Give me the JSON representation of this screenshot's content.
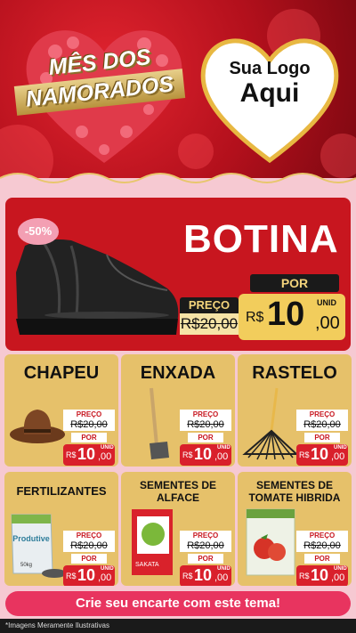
{
  "header": {
    "promo_line1": "MÊS DOS",
    "promo_line2": "NAMORADOS",
    "logo_line1": "Sua Logo",
    "logo_line2": "Aqui"
  },
  "hero": {
    "discount": "-50%",
    "title": "BOTINA",
    "old_label": "PREÇO",
    "old_price": "R$20,00",
    "por_label": "POR",
    "currency": "R$",
    "price_int": "10",
    "price_dec": ",00",
    "unit": "UNID"
  },
  "products": [
    {
      "title": "CHAPEU",
      "old_label": "PREÇO",
      "old_price": "R$20,00",
      "por_label": "POR",
      "currency": "R$",
      "price_int": "10",
      "price_dec": ",00",
      "unit": "UNID"
    },
    {
      "title": "ENXADA",
      "old_label": "PREÇO",
      "old_price": "R$20,00",
      "por_label": "POR",
      "currency": "R$",
      "price_int": "10",
      "price_dec": ",00",
      "unit": "UNID"
    },
    {
      "title": "RASTELO",
      "old_label": "PREÇO",
      "old_price": "R$20,00",
      "por_label": "POR",
      "currency": "R$",
      "price_int": "10",
      "price_dec": ",00",
      "unit": "UNID"
    },
    {
      "title": "FERTILIZANTES",
      "old_label": "PREÇO",
      "old_price": "R$20,00",
      "por_label": "POR",
      "currency": "R$",
      "price_int": "10",
      "price_dec": ",00",
      "unit": "UNID"
    },
    {
      "title": "SEMENTES DE ALFACE",
      "old_label": "PREÇO",
      "old_price": "R$20,00",
      "por_label": "POR",
      "currency": "R$",
      "price_int": "10",
      "price_dec": ",00",
      "unit": "UNID"
    },
    {
      "title": "SEMENTES DE TOMATE HIBRIDA",
      "old_label": "PREÇO",
      "old_price": "R$20,00",
      "por_label": "POR",
      "currency": "R$",
      "price_int": "10",
      "price_dec": ",00",
      "unit": "UNID"
    }
  ],
  "product_text": {
    "fertilizer_brand": "Produtive",
    "fertilizer_weight": "50kg",
    "seed_brand": "SAKATA"
  },
  "cta": "Crie seu encarte com este tema!",
  "footer": "*Imagens Meramente Ilustrativas",
  "colors": {
    "header_red": "#c8161f",
    "gold": "#e6c16a",
    "price_yellow": "#f2cd5c",
    "cta_pink": "#e8345f"
  }
}
